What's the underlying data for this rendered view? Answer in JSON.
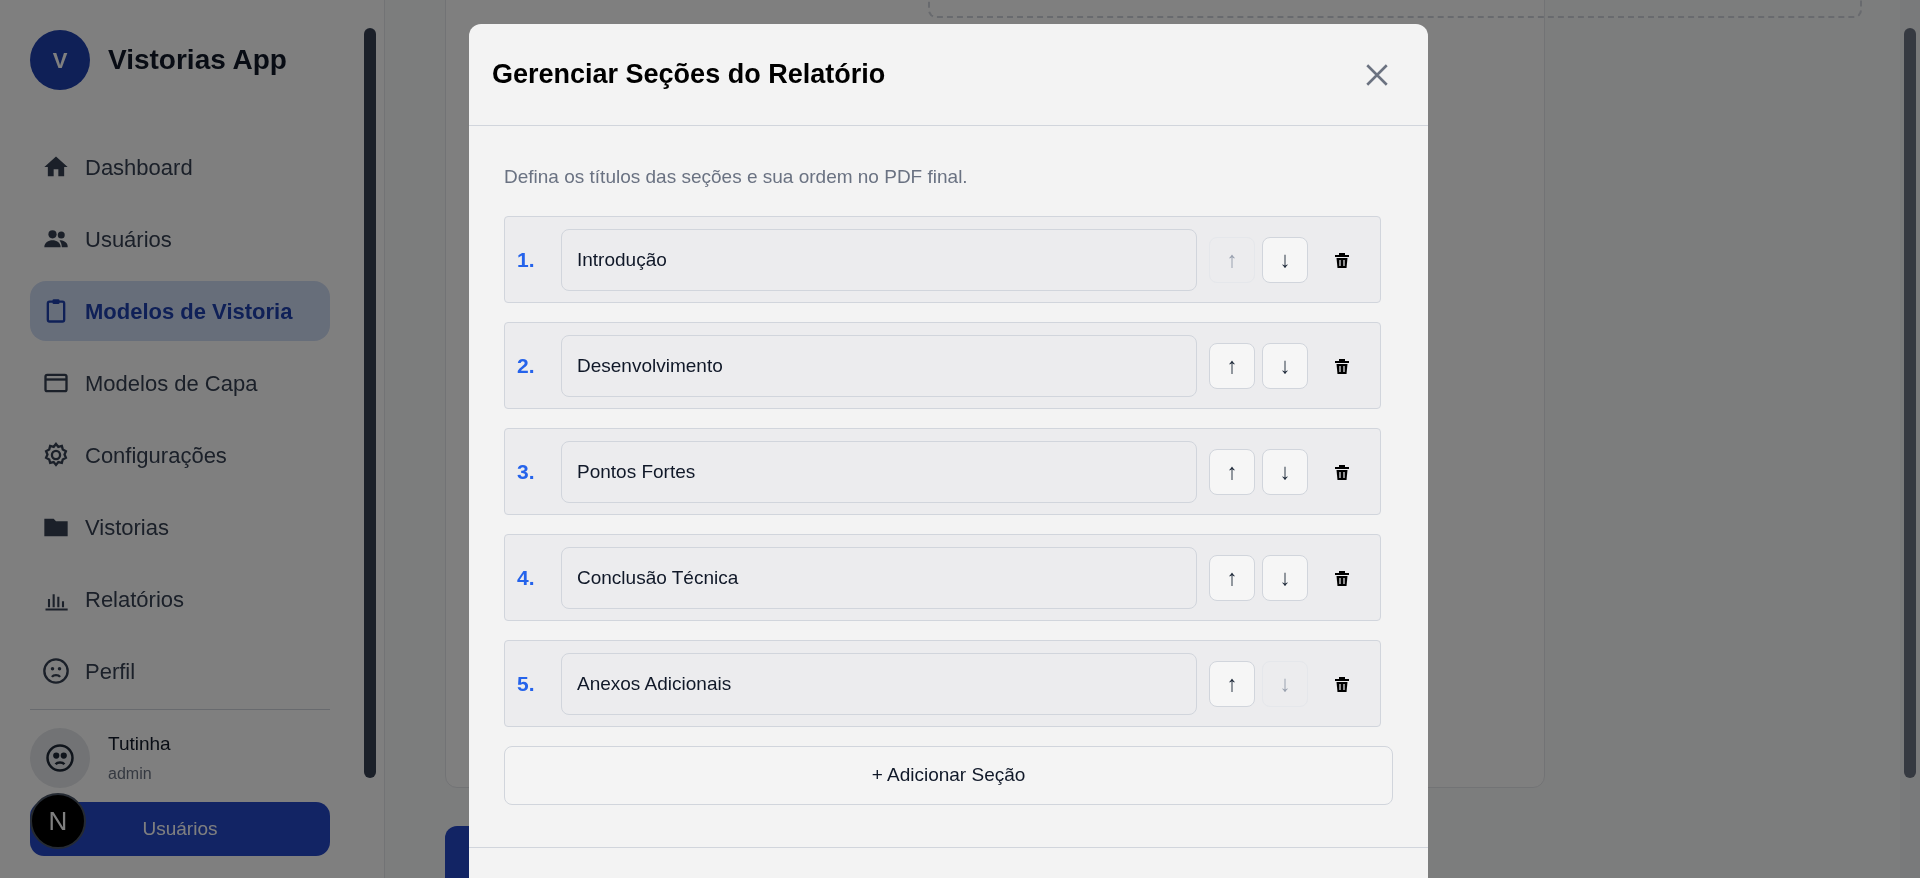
{
  "sidebar": {
    "logo_letter": "V",
    "app_name": "Vistorias App",
    "items": [
      {
        "label": "Dashboard",
        "selected": false
      },
      {
        "label": "Usuários",
        "selected": false
      },
      {
        "label": "Modelos de Vistoria",
        "selected": true
      },
      {
        "label": "Modelos de Capa",
        "selected": false
      },
      {
        "label": "Configurações",
        "selected": false
      },
      {
        "label": "Vistorias",
        "selected": false
      },
      {
        "label": "Relatórios",
        "selected": false
      },
      {
        "label": "Perfil",
        "selected": false
      }
    ],
    "user": {
      "name": "Tutinha",
      "role": "admin"
    },
    "button": "Usuários",
    "badge": "N"
  },
  "modal": {
    "title": "Gerenciar Seções do Relatório",
    "description": "Defina os títulos das seções e sua ordem no PDF final.",
    "sections": [
      {
        "number": "1.",
        "value": "Introdução",
        "up_disabled": true,
        "down_disabled": false
      },
      {
        "number": "2.",
        "value": "Desenvolvimento",
        "up_disabled": false,
        "down_disabled": false
      },
      {
        "number": "3.",
        "value": "Pontos Fortes",
        "up_disabled": false,
        "down_disabled": false
      },
      {
        "number": "4.",
        "value": "Conclusão Técnica",
        "up_disabled": false,
        "down_disabled": false
      },
      {
        "number": "5.",
        "value": "Anexos Adicionais",
        "up_disabled": false,
        "down_disabled": true
      }
    ],
    "up_symbol": "↑",
    "down_symbol": "↓",
    "add_button": "+ Adicionar Seção"
  }
}
